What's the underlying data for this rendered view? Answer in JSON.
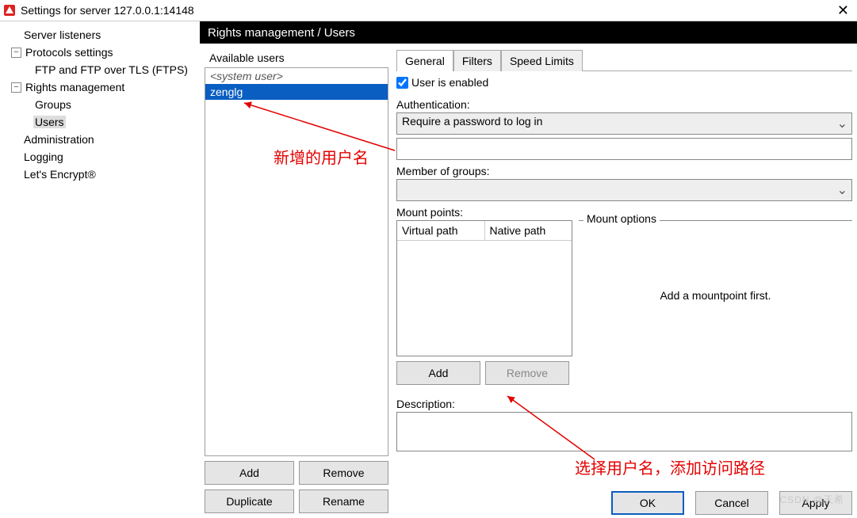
{
  "window": {
    "title": "Settings for server 127.0.0.1:14148",
    "close_glyph": "✕"
  },
  "nav": {
    "items": [
      {
        "label": "Server listeners",
        "depth": 0,
        "exp": ""
      },
      {
        "label": "Protocols settings",
        "depth": 0,
        "exp": "−"
      },
      {
        "label": "FTP and FTP over TLS (FTPS)",
        "depth": 1,
        "exp": ""
      },
      {
        "label": "Rights management",
        "depth": 0,
        "exp": "−"
      },
      {
        "label": "Groups",
        "depth": 1,
        "exp": ""
      },
      {
        "label": "Users",
        "depth": 1,
        "exp": "",
        "selected": true
      },
      {
        "label": "Administration",
        "depth": 0,
        "exp": ""
      },
      {
        "label": "Logging",
        "depth": 0,
        "exp": ""
      },
      {
        "label": "Let's Encrypt®",
        "depth": 0,
        "exp": ""
      }
    ]
  },
  "breadcrumb": "Rights management / Users",
  "users_panel": {
    "heading": "Available users",
    "system_user_label": "<system user>",
    "items": [
      "zenglg"
    ],
    "buttons": {
      "add": "Add",
      "remove": "Remove",
      "duplicate": "Duplicate",
      "rename": "Rename"
    }
  },
  "tabs": [
    "General",
    "Filters",
    "Speed Limits"
  ],
  "general": {
    "enabled_label": "User is enabled",
    "enabled_checked": true,
    "auth_label": "Authentication:",
    "auth_value": "Require a password to log in",
    "groups_label": "Member of groups:",
    "groups_value": "",
    "mount_label": "Mount points:",
    "mount_headers": [
      "Virtual path",
      "Native path"
    ],
    "mount_opts_heading": "Mount options",
    "mount_opts_msg": "Add a mountpoint first.",
    "mount_buttons": {
      "add": "Add",
      "remove": "Remove"
    },
    "desc_label": "Description:"
  },
  "footer": {
    "ok": "OK",
    "cancel": "Cancel",
    "apply": "Apply"
  },
  "annotations": {
    "a1": "新增的用户名",
    "a2": "选择用户名，添加访问路径"
  },
  "watermark": "CSDN @天希"
}
